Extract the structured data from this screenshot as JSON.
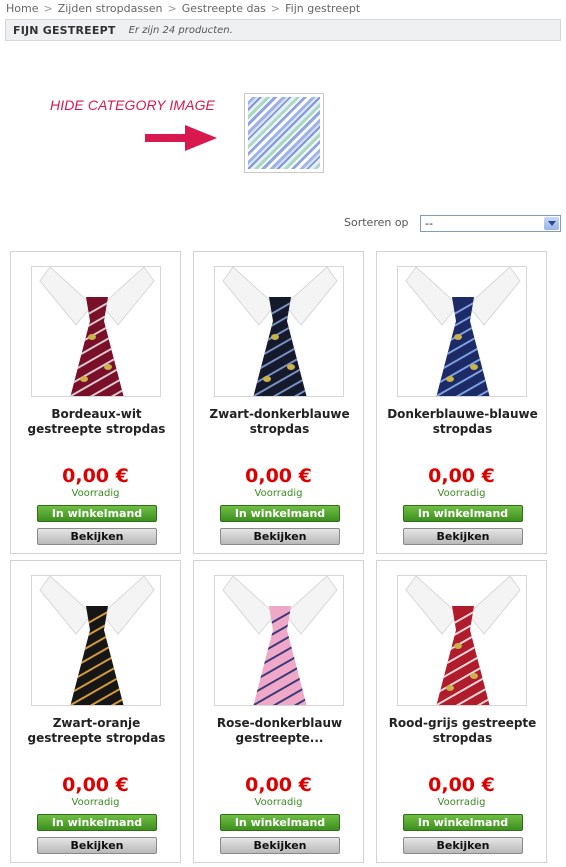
{
  "breadcrumb": {
    "items": [
      "Home",
      "Zijden stropdassen",
      "Gestreepte das",
      "Fijn gestreept"
    ],
    "separator": ">"
  },
  "category": {
    "title": "FIJN GESTREEPT",
    "count_text": "Er zijn 24 producten."
  },
  "annotation": {
    "label": "HIDE CATEGORY IMAGE",
    "color": "#d7194f"
  },
  "sort": {
    "label": "Sorteren op",
    "selected": "--"
  },
  "products": [
    {
      "name": "Bordeaux-wit gestreepte stropdas",
      "price": "0,00 €",
      "stock": "Voorradig",
      "cart_label": "In winkelmand",
      "view_label": "Bekijken",
      "tie_color": "#7a0f2a",
      "stripe_color": "#d9c9d0",
      "emblem": true
    },
    {
      "name": "Zwart-donkerblauwe stropdas",
      "price": "0,00 €",
      "stock": "Voorradig",
      "cart_label": "In winkelmand",
      "view_label": "Bekijken",
      "tie_color": "#141a2c",
      "stripe_color": "#7a90c0",
      "emblem": true
    },
    {
      "name": "Donkerblauwe-blauwe stropdas",
      "price": "0,00 €",
      "stock": "Voorradig",
      "cart_label": "In winkelmand",
      "view_label": "Bekijken",
      "tie_color": "#1c2a66",
      "stripe_color": "#7fa0e0",
      "emblem": true
    },
    {
      "name": "Zwart-oranje gestreepte stropdas",
      "price": "0,00 €",
      "stock": "Voorradig",
      "cart_label": "In winkelmand",
      "view_label": "Bekijken",
      "tie_color": "#161616",
      "stripe_color": "#d59a3a",
      "emblem": false
    },
    {
      "name": "Rose-donkerblauw gestreepte...",
      "price": "0,00 €",
      "stock": "Voorradig",
      "cart_label": "In winkelmand",
      "view_label": "Bekijken",
      "tie_color": "#f0a8c8",
      "stripe_color": "#3a3a7a",
      "emblem": false
    },
    {
      "name": "Rood-grijs gestreepte stropdas",
      "price": "0,00 €",
      "stock": "Voorradig",
      "cart_label": "In winkelmand",
      "view_label": "Bekijken",
      "tie_color": "#b01c2c",
      "stripe_color": "#e8d8dc",
      "emblem": true
    }
  ],
  "colors": {
    "price": "#dd0000",
    "stock": "#3a8a22",
    "cart_button": "#4f9f2a",
    "view_button": "#c4c4c4"
  }
}
